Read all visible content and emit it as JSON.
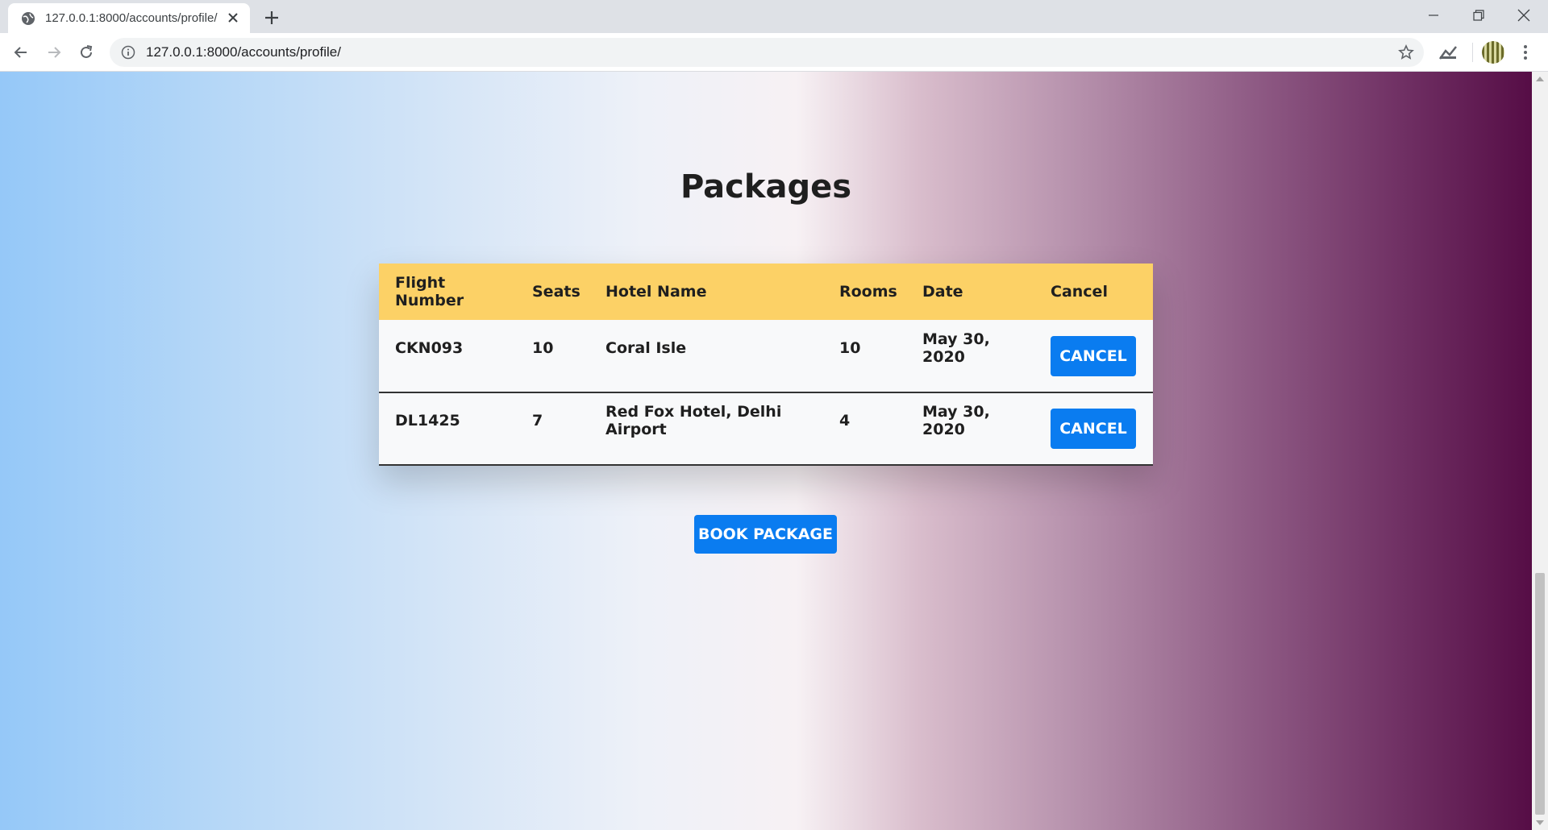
{
  "browser": {
    "tab_title": "127.0.0.1:8000/accounts/profile/",
    "url": "127.0.0.1:8000/accounts/profile/"
  },
  "page": {
    "title": "Packages",
    "table": {
      "headers": [
        "Flight Number",
        "Seats",
        "Hotel Name",
        "Rooms",
        "Date",
        "Cancel"
      ],
      "rows": [
        {
          "flight": "CKN093",
          "seats": "10",
          "hotel": "Coral Isle",
          "rooms": "10",
          "date": "May 30, 2020",
          "action": "CANCEL"
        },
        {
          "flight": "DL1425",
          "seats": "7",
          "hotel": "Red Fox Hotel, Delhi Airport",
          "rooms": "4",
          "date": "May 30, 2020",
          "action": "CANCEL"
        }
      ]
    },
    "book_button": "BOOK PACKAGE"
  },
  "colors": {
    "table_header": "#fcd166",
    "button": "#0a7cf0"
  }
}
